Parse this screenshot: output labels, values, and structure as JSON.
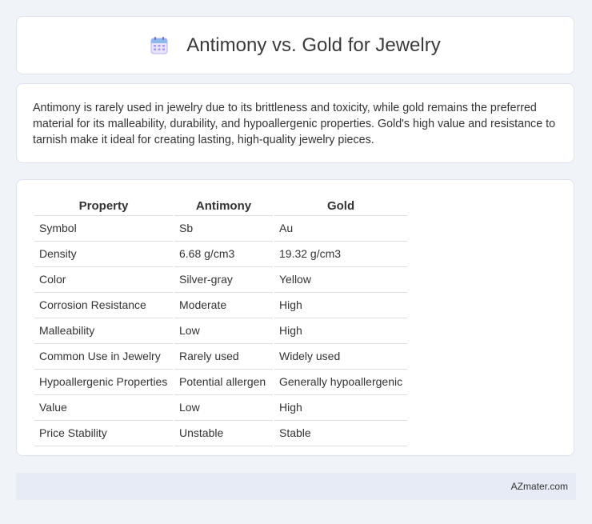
{
  "header": {
    "title": "Antimony vs. Gold for Jewelry",
    "icon": "calendar-icon"
  },
  "description": "Antimony is rarely used in jewelry due to its brittleness and toxicity, while gold remains the preferred material for its malleability, durability, and hypoallergenic properties. Gold's high value and resistance to tarnish make it ideal for creating lasting, high-quality jewelry pieces.",
  "table": {
    "headers": [
      "Property",
      "Antimony",
      "Gold"
    ],
    "rows": [
      [
        "Symbol",
        "Sb",
        "Au"
      ],
      [
        "Density",
        "6.68 g/cm3",
        "19.32 g/cm3"
      ],
      [
        "Color",
        "Silver-gray",
        "Yellow"
      ],
      [
        "Corrosion Resistance",
        "Moderate",
        "High"
      ],
      [
        "Malleability",
        "Low",
        "High"
      ],
      [
        "Common Use in Jewelry",
        "Rarely used",
        "Widely used"
      ],
      [
        "Hypoallergenic Properties",
        "Potential allergen",
        "Generally hypoallergenic"
      ],
      [
        "Value",
        "Low",
        "High"
      ],
      [
        "Price Stability",
        "Unstable",
        "Stable"
      ]
    ]
  },
  "footer": {
    "brand": "AZmater.com"
  },
  "colors": {
    "background": "#f0f3f8",
    "card": "#ffffff",
    "footer": "#e6ebf5",
    "icon_accent": "#8b7fd6"
  }
}
